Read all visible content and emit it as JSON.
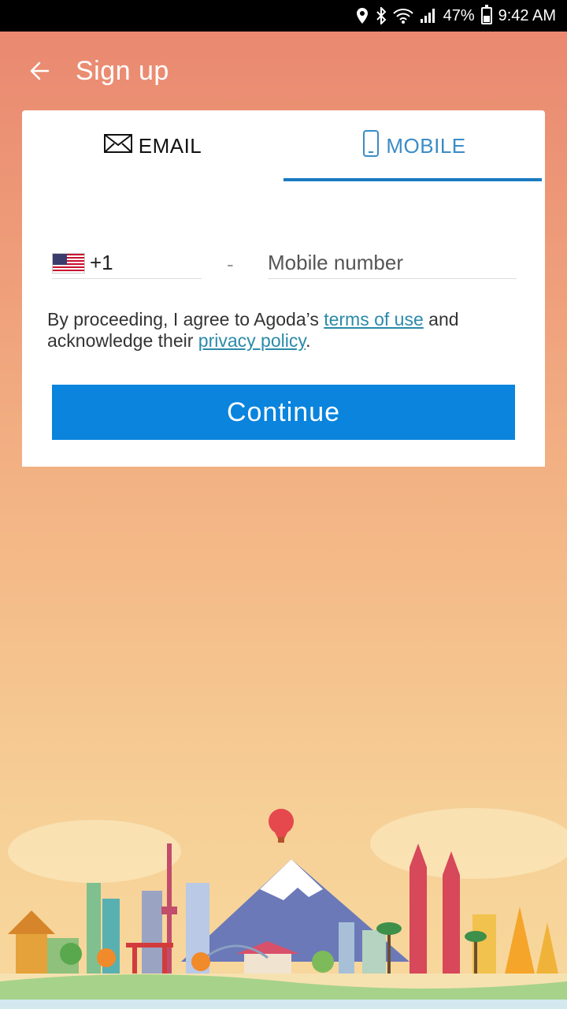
{
  "status_bar": {
    "battery": "47%",
    "time": "9:42 AM",
    "icons": [
      "location-icon",
      "bluetooth-icon",
      "wifi-icon",
      "signal-icon",
      "battery-icon"
    ],
    "battery_level": 0.47
  },
  "header": {
    "back_icon": "arrow-left-icon",
    "title": "Sign up"
  },
  "tabs": [
    {
      "icon": "envelope-icon",
      "label": "EMAIL",
      "selected": false
    },
    {
      "icon": "phone-icon",
      "label": "MOBILE",
      "selected": true
    }
  ],
  "phone_form": {
    "country_flag": "us-flag-icon",
    "country_code": "+1",
    "separator": "-",
    "mobile_placeholder": "Mobile number",
    "mobile_value": ""
  },
  "terms": {
    "prefix": "By proceeding, I agree to Agoda’s ",
    "terms_link": "terms of use",
    "middle": " and acknowledge their ",
    "privacy_link": "privacy policy",
    "suffix": "."
  },
  "continue_button": "Continue",
  "colors": {
    "accent": "#0a84dd",
    "tab_indicator": "#1a7bc0",
    "link": "#2b8aaa",
    "bg_top": "#e9866f",
    "bg_bottom": "#f8d99d"
  },
  "illustration": "travel-skyline-image"
}
